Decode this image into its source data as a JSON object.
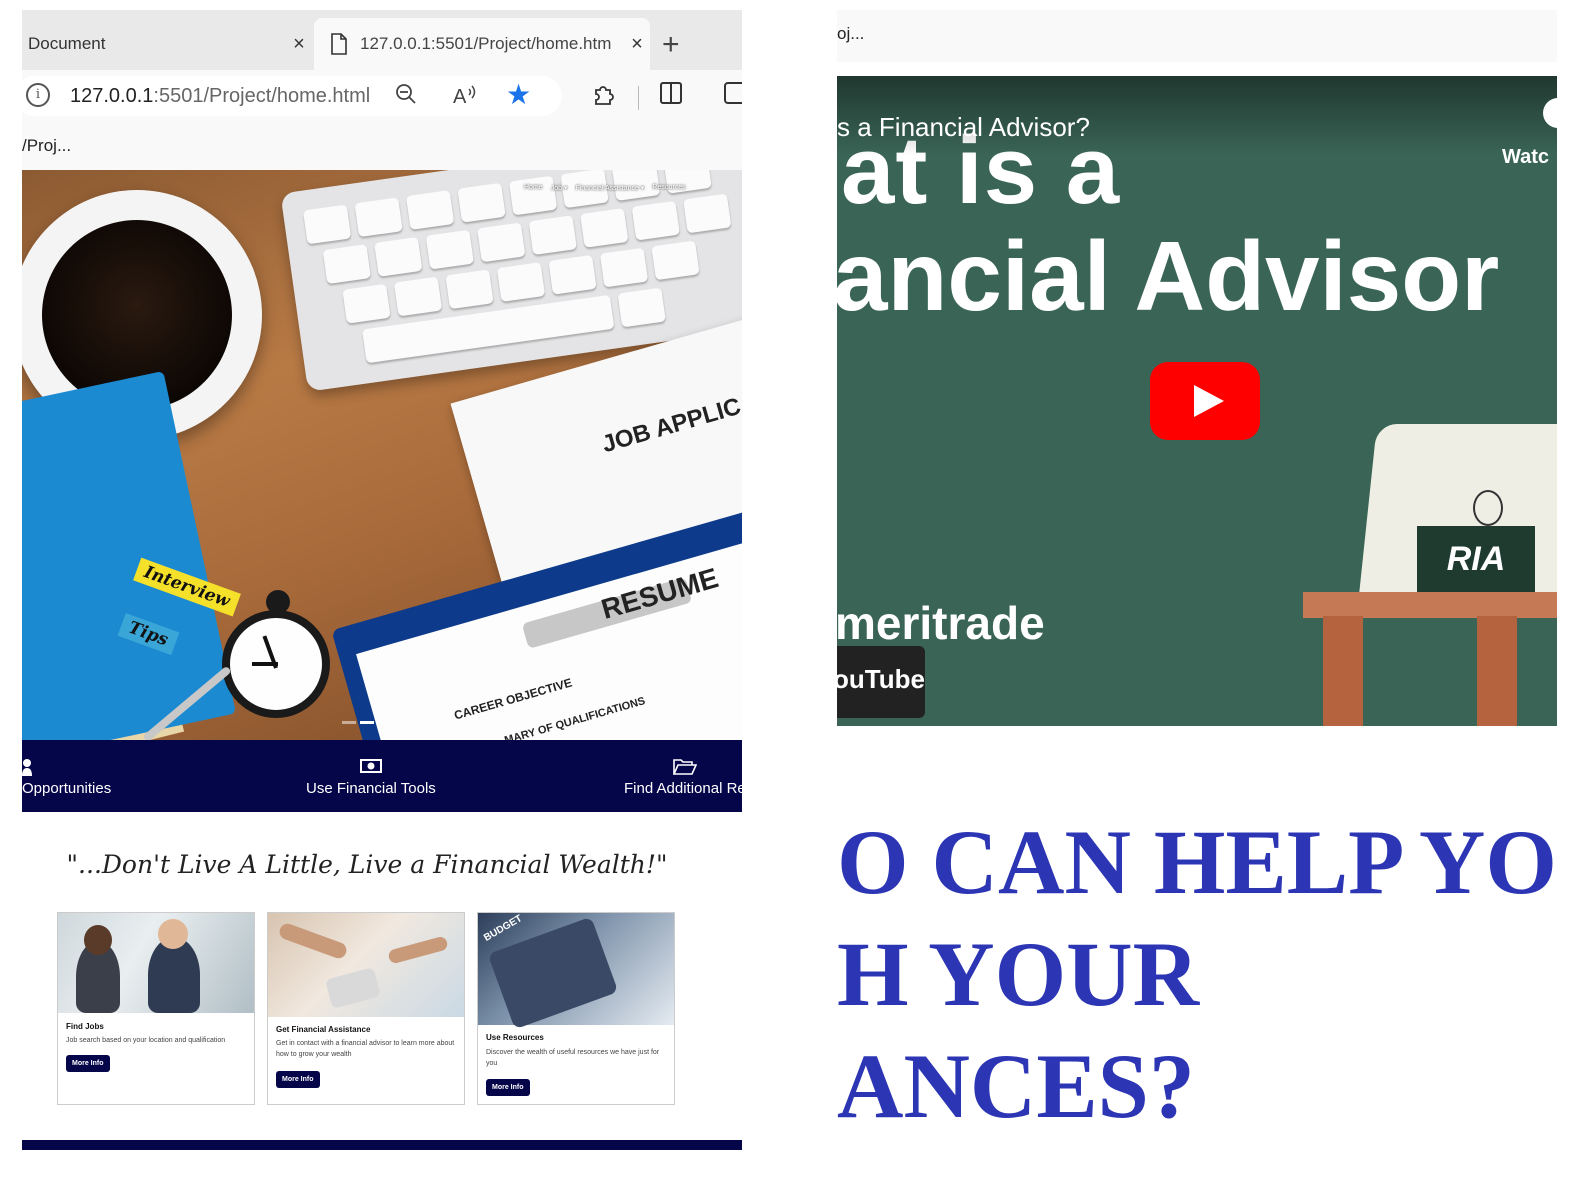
{
  "browser": {
    "tabs": [
      {
        "title": "Document",
        "active": false
      },
      {
        "title": "127.0.0.1:5501/Project/home.htm",
        "active": true
      }
    ],
    "new_tab_glyph": "+",
    "close_glyph": "×",
    "address": {
      "host": "127.0.0.1",
      "rest": ":5501/Project/home.html"
    },
    "favorites_item": "/Proj...",
    "icons": [
      "info-icon",
      "zoom-out-icon",
      "read-aloud-icon",
      "star-icon",
      "extensions-icon",
      "split-screen-icon",
      "collections-icon"
    ],
    "star_color": "#1a73e8"
  },
  "site": {
    "nav": [
      "Home",
      "Job ▾",
      "Financial Assistance ▾",
      "Resources"
    ],
    "hero_image": {
      "texts": {
        "job_application": "JOB APPLIC",
        "resume": "RESUME",
        "career_objective": "CAREER OBJECTIVE",
        "qualifications": "MARY OF QUALIFICATIONS",
        "sticky_interview": "Interview",
        "sticky_tips": "Tips"
      }
    },
    "features": [
      {
        "label": "Opportunities",
        "icon": "user-icon"
      },
      {
        "label": "Use Financial Tools",
        "icon": "money-icon"
      },
      {
        "label": "Find Additional Re",
        "icon": "folder-open-icon"
      }
    ],
    "quote": "\"...Don't Live A Little, Live a Financial Wealth!\"",
    "cards": [
      {
        "title": "Find Jobs",
        "description": "Job search based on your location and qualification",
        "button": "More Info"
      },
      {
        "title": "Get Financial Assistance",
        "description": "Get in contact with a financial advisor to learn more about how to grow your wealth",
        "button": "More Info"
      },
      {
        "title": "Use Resources",
        "description": "Discover the wealth of useful resources we have just for you",
        "button": "More Info",
        "image_label": "BUDGET"
      }
    ],
    "brand_color": "#05054a"
  },
  "right_panel": {
    "favorites_item": "oj...",
    "video": {
      "title": "s a Financial Advisor?",
      "watch_label": "Watc",
      "big_line1": "at is a",
      "big_line2": "ancial Advisor",
      "sign_text": "RIA",
      "brand_text": "meritrade",
      "badge_text": "ouTube"
    },
    "heading_lines": [
      "O CAN HELP YO",
      "H YOUR",
      "ANCES?"
    ],
    "heading_color": "#2c36b5"
  }
}
